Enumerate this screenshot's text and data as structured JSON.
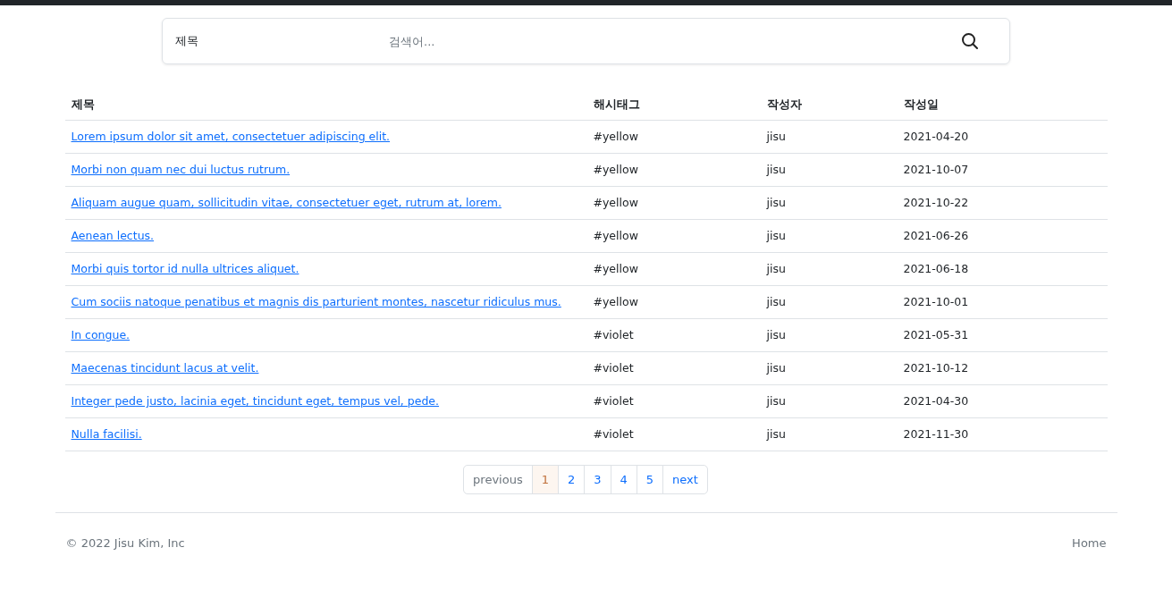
{
  "search": {
    "field_type": "제목",
    "placeholder": "검색어..."
  },
  "table": {
    "columns": [
      "제목",
      "해시태그",
      "작성자",
      "작성일"
    ],
    "rows": [
      {
        "title": "Lorem ipsum dolor sit amet, consectetuer adipiscing elit.",
        "hashtag": "#yellow",
        "author": "jisu",
        "date": "2021-04-20"
      },
      {
        "title": "Morbi non quam nec dui luctus rutrum.",
        "hashtag": "#yellow",
        "author": "jisu",
        "date": "2021-10-07"
      },
      {
        "title": "Aliquam augue quam, sollicitudin vitae, consectetuer eget, rutrum at, lorem.",
        "hashtag": "#yellow",
        "author": "jisu",
        "date": "2021-10-22"
      },
      {
        "title": "Aenean lectus.",
        "hashtag": "#yellow",
        "author": "jisu",
        "date": "2021-06-26"
      },
      {
        "title": "Morbi quis tortor id nulla ultrices aliquet.",
        "hashtag": "#yellow",
        "author": "jisu",
        "date": "2021-06-18"
      },
      {
        "title": "Cum sociis natoque penatibus et magnis dis parturient montes, nascetur ridiculus mus.",
        "hashtag": "#yellow",
        "author": "jisu",
        "date": "2021-10-01"
      },
      {
        "title": "In congue.",
        "hashtag": "#violet",
        "author": "jisu",
        "date": "2021-05-31"
      },
      {
        "title": "Maecenas tincidunt lacus at velit.",
        "hashtag": "#violet",
        "author": "jisu",
        "date": "2021-10-12"
      },
      {
        "title": "Integer pede justo, lacinia eget, tincidunt eget, tempus vel, pede.",
        "hashtag": "#violet",
        "author": "jisu",
        "date": "2021-04-30"
      },
      {
        "title": "Nulla facilisi.",
        "hashtag": "#violet",
        "author": "jisu",
        "date": "2021-11-30"
      }
    ]
  },
  "pagination": [
    {
      "label": "previous",
      "selected": false,
      "disabled": true
    },
    {
      "label": "1",
      "selected": true,
      "disabled": false
    },
    {
      "label": "2",
      "selected": false,
      "disabled": false
    },
    {
      "label": "3",
      "selected": false,
      "disabled": false
    },
    {
      "label": "4",
      "selected": false,
      "disabled": false
    },
    {
      "label": "5",
      "selected": false,
      "disabled": false
    },
    {
      "label": "next",
      "selected": false,
      "disabled": false
    }
  ],
  "footer": {
    "copyright": "© 2022 Jisu Kim, Inc",
    "link": "Home"
  }
}
